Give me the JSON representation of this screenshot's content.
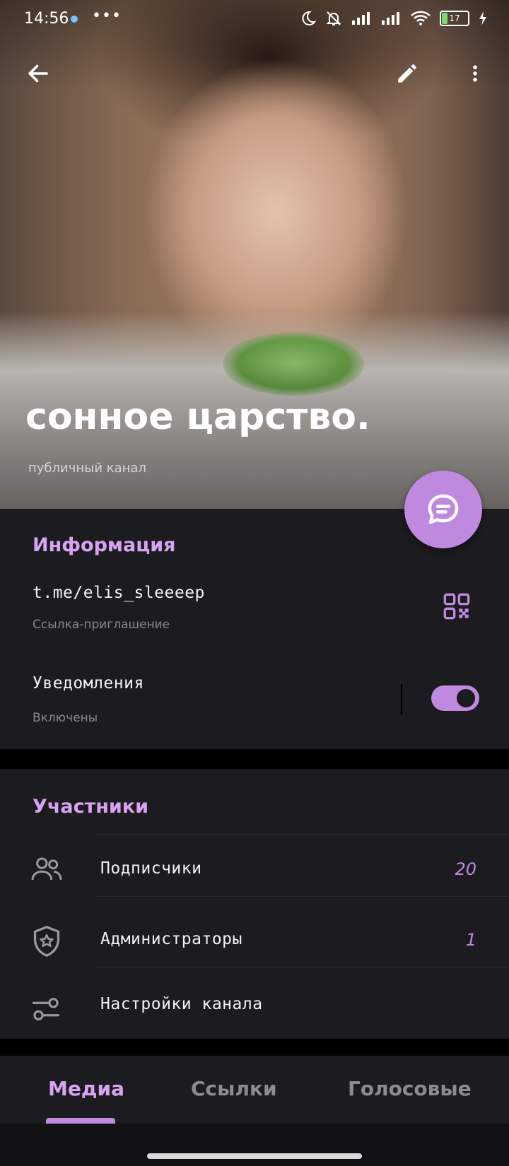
{
  "statusbar": {
    "time": "14:56",
    "more": "•••",
    "battery": "17"
  },
  "header": {
    "title": "сонное царство.",
    "subtitle": "публичный канал"
  },
  "info": {
    "section_title": "Информация",
    "link": "t.me/elis_sleeeep",
    "link_caption": "Ссылка-приглашение",
    "notifications_label": "Уведомления",
    "notifications_state": "Включены",
    "notifications_on": true
  },
  "members": {
    "section_title": "Участники",
    "items": [
      {
        "label": "Подписчики",
        "count": "20",
        "icon": "people-icon"
      },
      {
        "label": "Администраторы",
        "count": "1",
        "icon": "shield-star-icon"
      },
      {
        "label": "Настройки канала",
        "count": "",
        "icon": "sliders-icon"
      }
    ]
  },
  "tabs": [
    {
      "label": "Медиа",
      "active": true
    },
    {
      "label": "Ссылки",
      "active": false
    },
    {
      "label": "Голосовые",
      "active": false
    }
  ],
  "colors": {
    "accent": "#c089e0",
    "accent_text": "#d7a3f2",
    "card_bg": "#1c1b1f",
    "page_bg": "#000000"
  }
}
